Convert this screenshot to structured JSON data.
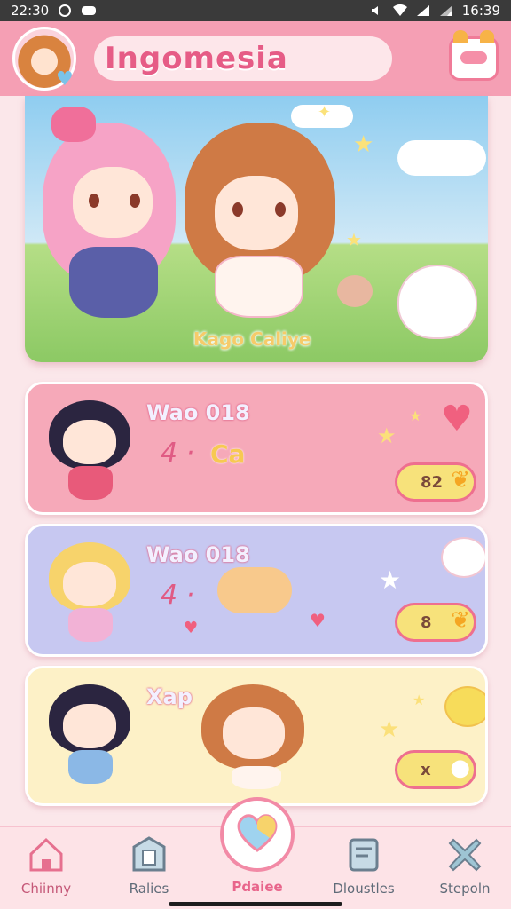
{
  "status_bar": {
    "time_left": "22:30",
    "time_right": "16:39"
  },
  "header": {
    "title": "Ingomesia"
  },
  "hero": {
    "caption": "Kago Caliye"
  },
  "cards": [
    {
      "title": "Wao 018",
      "stat": "4 ·",
      "mid": "Ca",
      "badge": "82"
    },
    {
      "title": "Wao 018",
      "stat": "4 ·",
      "mid": "",
      "badge": "8"
    },
    {
      "title": "Xap",
      "stat": "",
      "mid": "",
      "badge": "x"
    }
  ],
  "nav": {
    "items": [
      {
        "label": "Chiinny",
        "icon": "house-icon"
      },
      {
        "label": "Ralies",
        "icon": "mailbox-icon"
      },
      {
        "label": "Pdaiee",
        "icon": "heart-icon"
      },
      {
        "label": "Dloustles",
        "icon": "clipboard-icon"
      },
      {
        "label": "Stepoln",
        "icon": "cross-icon"
      }
    ]
  },
  "colors": {
    "header_bg": "#f59fb4",
    "accent": "#e65c86",
    "card_pink": "#f6a9b9",
    "card_lavender": "#c7c8f1",
    "card_yellow": "#fdf1c7"
  }
}
